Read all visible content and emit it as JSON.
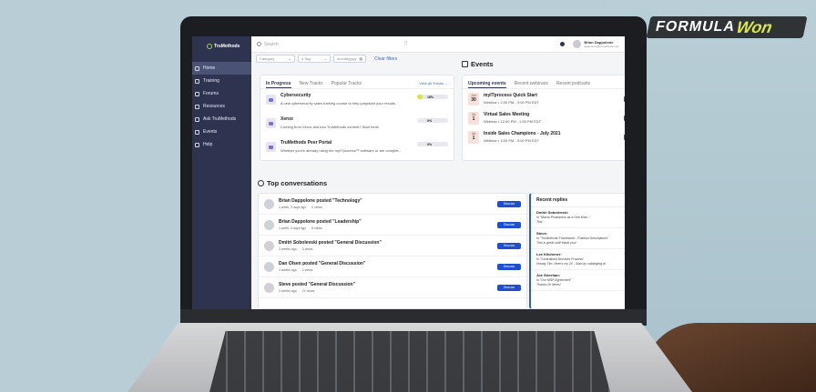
{
  "logo": {
    "formula": "FORMULA",
    "won": "Won"
  },
  "app": {
    "brand": "TruMethods",
    "nav": [
      {
        "label": "Home",
        "active": true
      },
      {
        "label": "Training",
        "active": false
      },
      {
        "label": "Forums",
        "active": false
      },
      {
        "label": "Resources",
        "active": false
      },
      {
        "label": "Ask TruMethods",
        "active": false
      },
      {
        "label": "Events",
        "active": false
      },
      {
        "label": "Help",
        "active": false
      }
    ],
    "search_placeholder": "Search",
    "user": {
      "name": "Brian Dappolone",
      "sub": "dappolone@trumethods.com"
    },
    "filters": {
      "category": "Category",
      "tag": "# Tag",
      "date": "mm/dd/yyyy",
      "clear": "Clear filters"
    },
    "tracks": {
      "tabs": [
        "In Progress",
        "New Tracks",
        "Popular Tracks"
      ],
      "view_all": "View all Tracks →",
      "items": [
        {
          "name": "Cybersecurity",
          "desc": "A new cybersecurity sales training course to help jumpstart your results.",
          "progress": 18,
          "progress_label": "18%"
        },
        {
          "name": "Xerox",
          "desc": "Coming from Xerox and into TruMethods content? Start here!",
          "progress": 0,
          "progress_label": "0%"
        },
        {
          "name": "TruMethods Peer Portal",
          "desc": "Whether you're already using the myITprocess™ software or are complet...",
          "progress": 0,
          "progress_label": "0%"
        }
      ]
    },
    "events": {
      "title": "Events",
      "tabs": [
        "Upcoming events",
        "Recent webinars",
        "Recent podcasts"
      ],
      "items": [
        {
          "month": "Jun",
          "day": "30",
          "name": "myITprocess Quick Start",
          "meta": "Webinar  •  2:00 PM - 3:00 PM EDT"
        },
        {
          "month": "Jul",
          "day": "1",
          "name": "Virtual Sales Meeting",
          "meta": "Webinar  •  12:00 PM - 1:00 PM EDT"
        },
        {
          "month": "Jul",
          "day": "1",
          "name": "Inside Sales Champions - July 2021",
          "meta": "Webinar  •  4:00 PM - 5:00 PM EDT"
        }
      ]
    },
    "conversations": {
      "title": "Top conversations",
      "discuss_label": "Discuss",
      "items": [
        {
          "title": "Brian Dappolone posted \"Technology\"",
          "time": "1 week, 3 days ago",
          "views": "0 views"
        },
        {
          "title": "Brian Dappolone posted \"Leadership\"",
          "time": "1 week, 3 days ago",
          "views": "6 views"
        },
        {
          "title": "Dmitri Sobolevski posted \"General Discussion\"",
          "time": "3 weeks ago",
          "views": "3 views"
        },
        {
          "title": "Dan Olsen posted \"General Discussion\"",
          "time": "3 weeks ago",
          "views": "2 views"
        },
        {
          "title": "Steve posted \"General Discussion\"",
          "time": "3 weeks ago",
          "views": "21 views"
        }
      ]
    },
    "replies": {
      "title": "Recent replies",
      "items": [
        {
          "name": "Dmitri Sobolevski:",
          "in": "In \"Macro Picatomics as a One Man...\"",
          "text": "Test",
          "time": "2 w"
        },
        {
          "name": "Steve:",
          "in": "In \"TruMethods Framework - Position Descriptions\"",
          "text": "This is great stuff thank you!",
          "time": "2 w"
        },
        {
          "name": "Lee Kitchener:",
          "in": "In \"Centralized Services Process\"",
          "text": "Howdy Tim. Here's my 2¢ - Start by cataloging al",
          "time": "2 w"
        },
        {
          "name": "Joe Sheehan:",
          "in": "In \"Our MSP Agreement\"",
          "text": "Thanks Dr Mees!",
          "time": "2 w"
        }
      ]
    }
  }
}
